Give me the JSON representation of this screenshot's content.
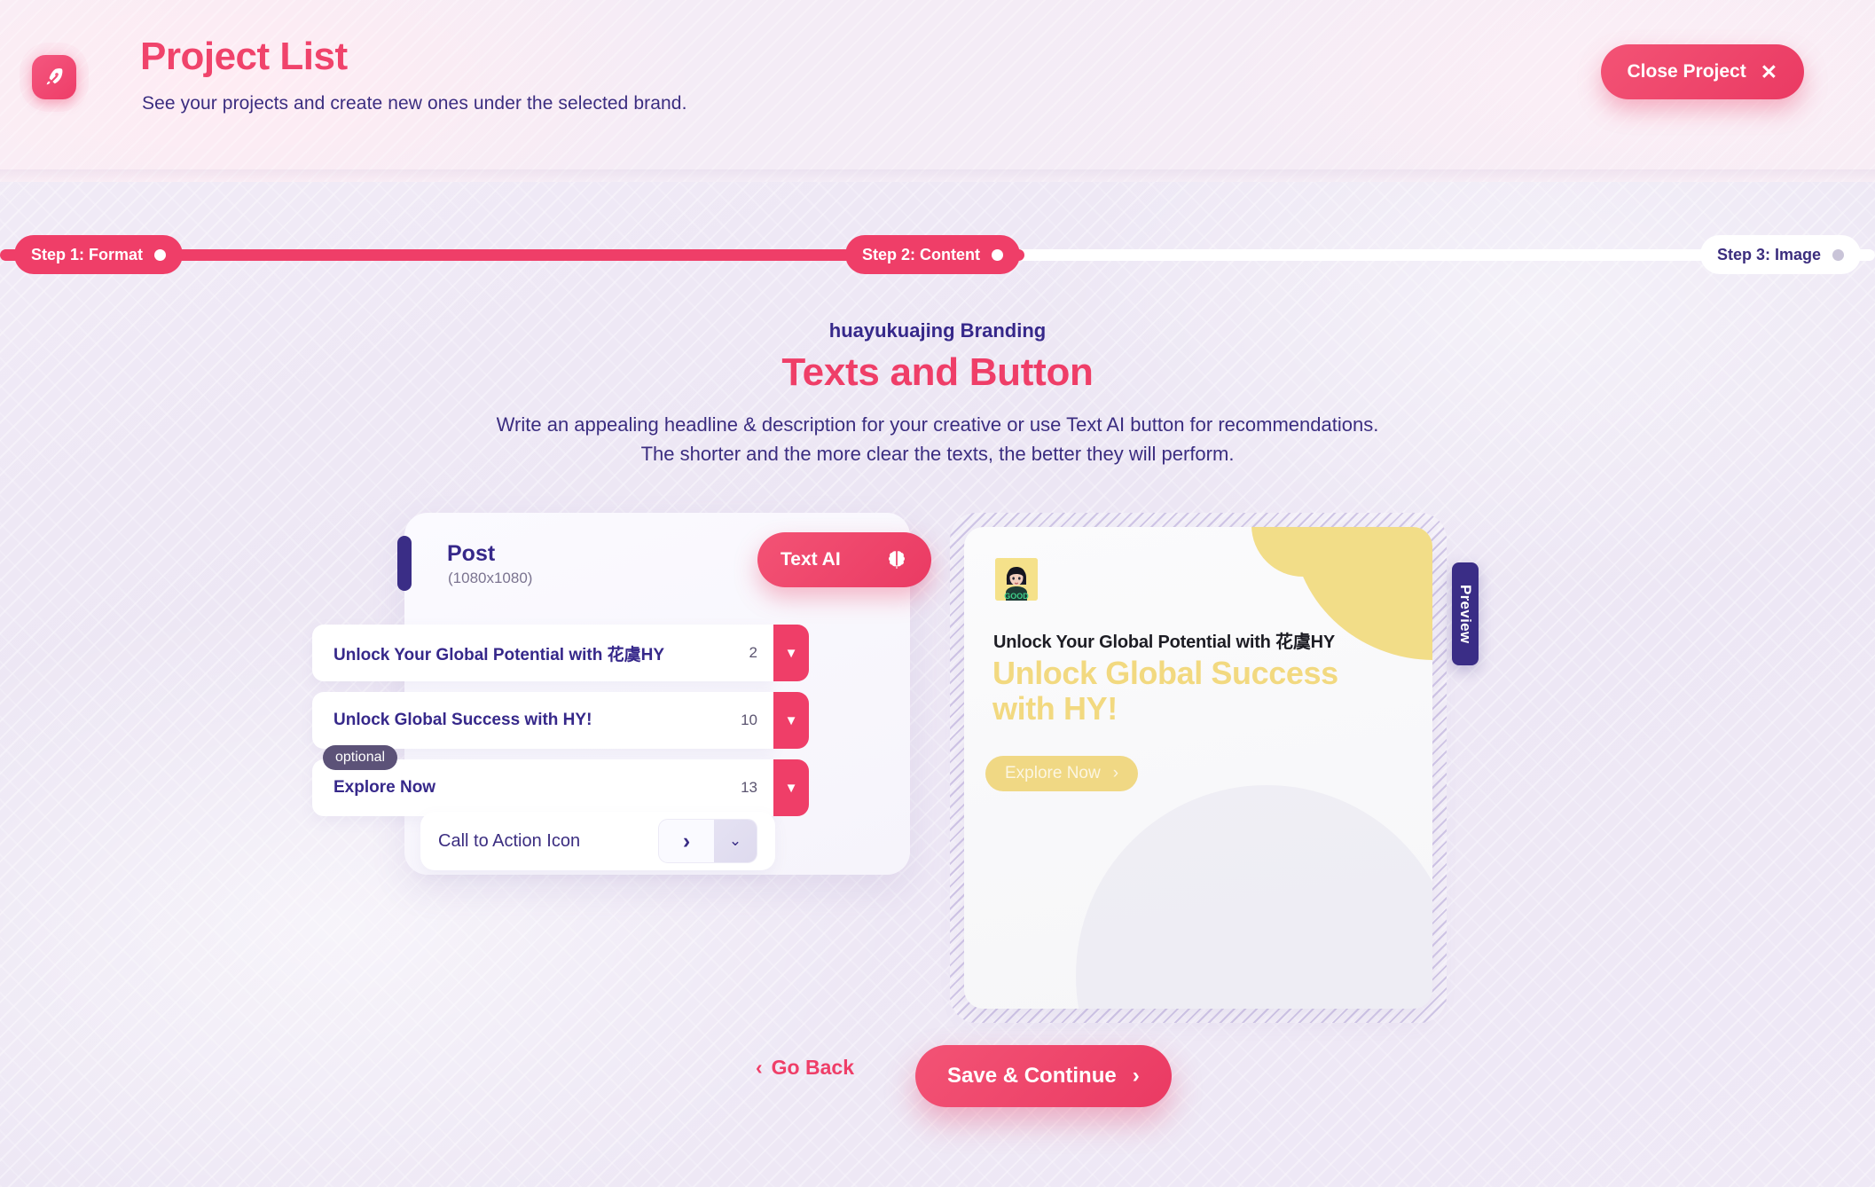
{
  "header": {
    "title": "Project List",
    "subtitle": "See your projects and create new ones under the selected brand.",
    "close_label": "Close Project",
    "close_icon_glyph": "✕",
    "accent_color": "#ef3e68",
    "navy_color": "#3b2d80"
  },
  "stepper": {
    "steps": [
      {
        "label": "Step 1: Format",
        "state": "complete"
      },
      {
        "label": "Step 2: Content",
        "state": "active"
      },
      {
        "label": "Step 3: Image",
        "state": "upcoming"
      }
    ]
  },
  "content": {
    "brand": "huayukuajing Branding",
    "title": "Texts and Button",
    "description_line1": "Write an appealing headline & description for your creative or use Text AI button for recommendations.",
    "description_line2": "The shorter and the more clear the texts, the better they will perform."
  },
  "form": {
    "format_name": "Post",
    "format_dimensions": "(1080x1080)",
    "text_ai_label": "Text AI",
    "fields": [
      {
        "value": "Unlock Your Global Potential with 花虞HY",
        "count": "2",
        "optional": false,
        "dropdown_glyph": "▼"
      },
      {
        "value": "Unlock Global Success with HY!",
        "count": "10",
        "optional": false,
        "dropdown_glyph": "▼"
      },
      {
        "value": "Explore Now",
        "count": "13",
        "optional": true,
        "optional_label": "optional",
        "dropdown_glyph": "▼"
      }
    ],
    "cta_icon_label": "Call to Action Icon",
    "cta_icon_glyph": "›",
    "cta_chevron_glyph": "⌄"
  },
  "preview": {
    "tab_label": "Preview",
    "headline": "Unlock Your Global Potential with 花虞HY",
    "subheadline": "Unlock Global Success with HY!",
    "cta_label": "Explore Now",
    "cta_arrow_glyph": "›",
    "accent_yellow": "#f2dd88"
  },
  "footer": {
    "go_back_label": "Go Back",
    "go_back_glyph": "‹",
    "save_label": "Save & Continue",
    "save_glyph": "›"
  }
}
